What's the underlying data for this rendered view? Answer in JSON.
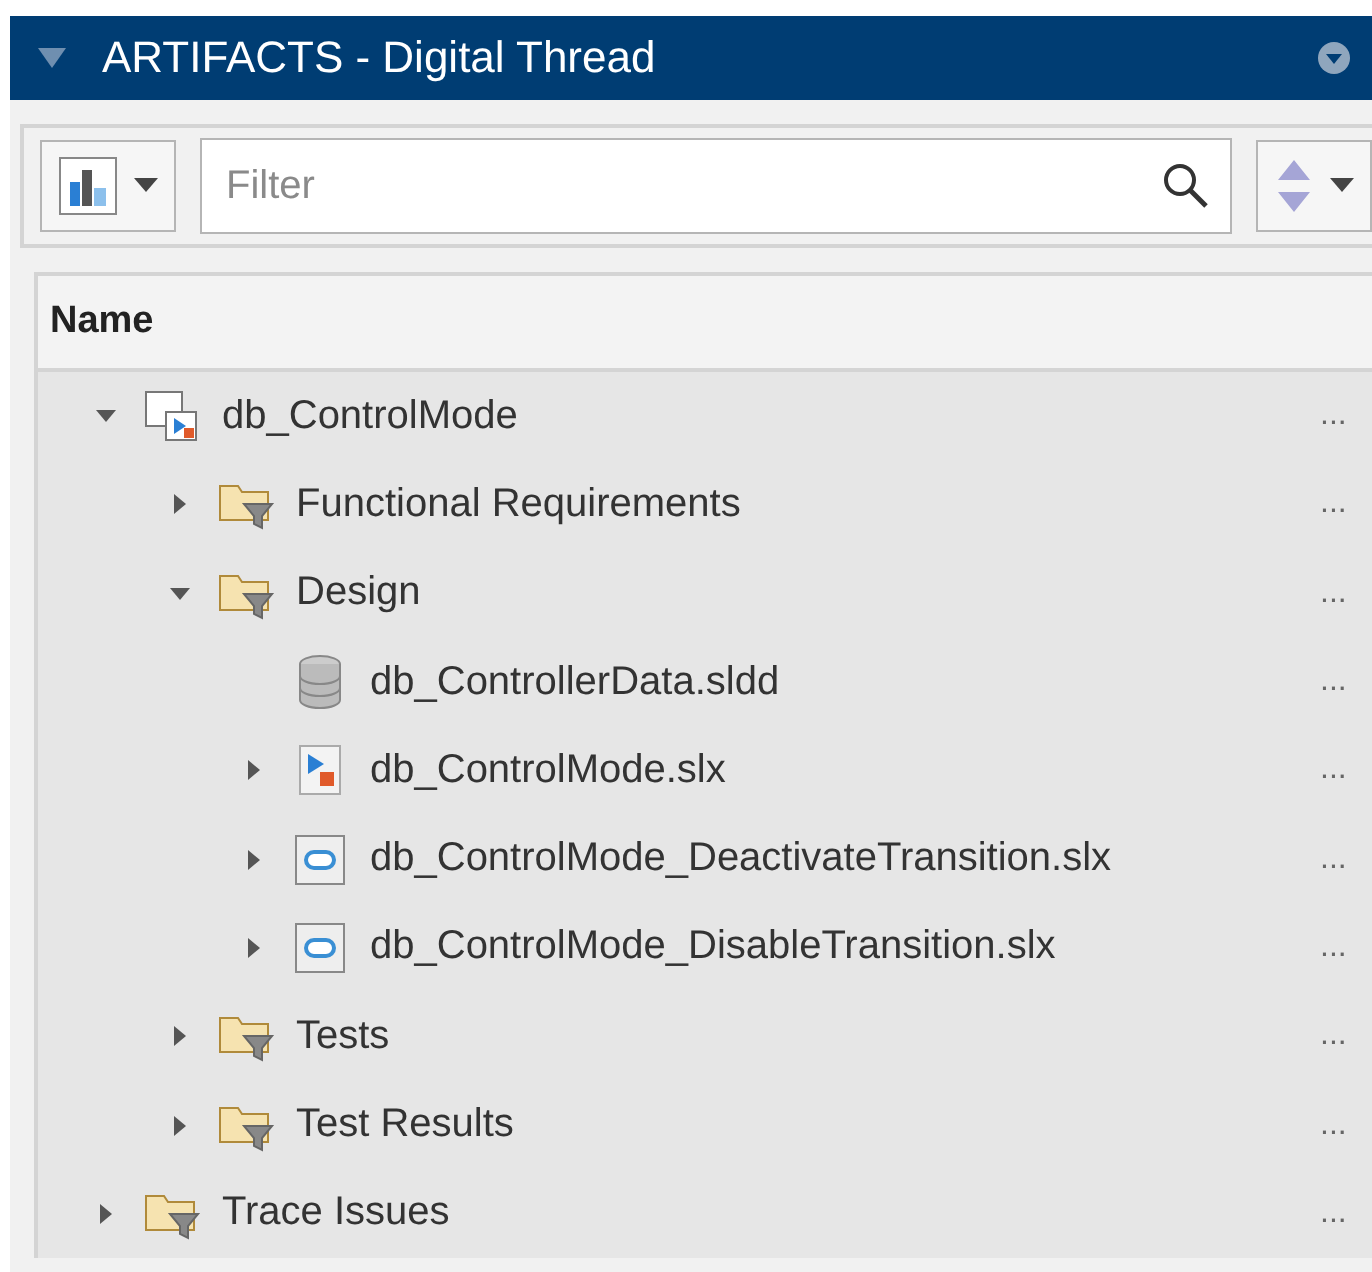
{
  "panel": {
    "title": "ARTIFACTS - Digital Thread",
    "expanded": true
  },
  "toolbar": {
    "filter": {
      "placeholder": "Filter"
    }
  },
  "table": {
    "columns": [
      "Name"
    ],
    "rows": [
      {
        "kind": "project",
        "name": "db_ControlMode",
        "expanded": true,
        "more": "...",
        "children": [
          {
            "kind": "folder",
            "name": "Functional Requirements",
            "expanded": false,
            "more": "..."
          },
          {
            "kind": "folder",
            "name": "Design",
            "expanded": true,
            "more": "...",
            "children": [
              {
                "kind": "dictionary",
                "name": "db_ControllerData.sldd",
                "more": "..."
              },
              {
                "kind": "model",
                "name": "db_ControlMode.slx",
                "expanded": false,
                "more": "..."
              },
              {
                "kind": "subsystem",
                "name": "db_ControlMode_DeactivateTransition.slx",
                "expanded": false,
                "more": "..."
              },
              {
                "kind": "subsystem",
                "name": "db_ControlMode_DisableTransition.slx",
                "expanded": false,
                "more": "..."
              }
            ]
          },
          {
            "kind": "folder",
            "name": "Tests",
            "expanded": false,
            "more": "..."
          },
          {
            "kind": "folder",
            "name": "Test Results",
            "expanded": false,
            "more": "..."
          }
        ]
      },
      {
        "kind": "folder",
        "name": "Trace Issues",
        "expanded": false,
        "more": "..."
      }
    ]
  }
}
